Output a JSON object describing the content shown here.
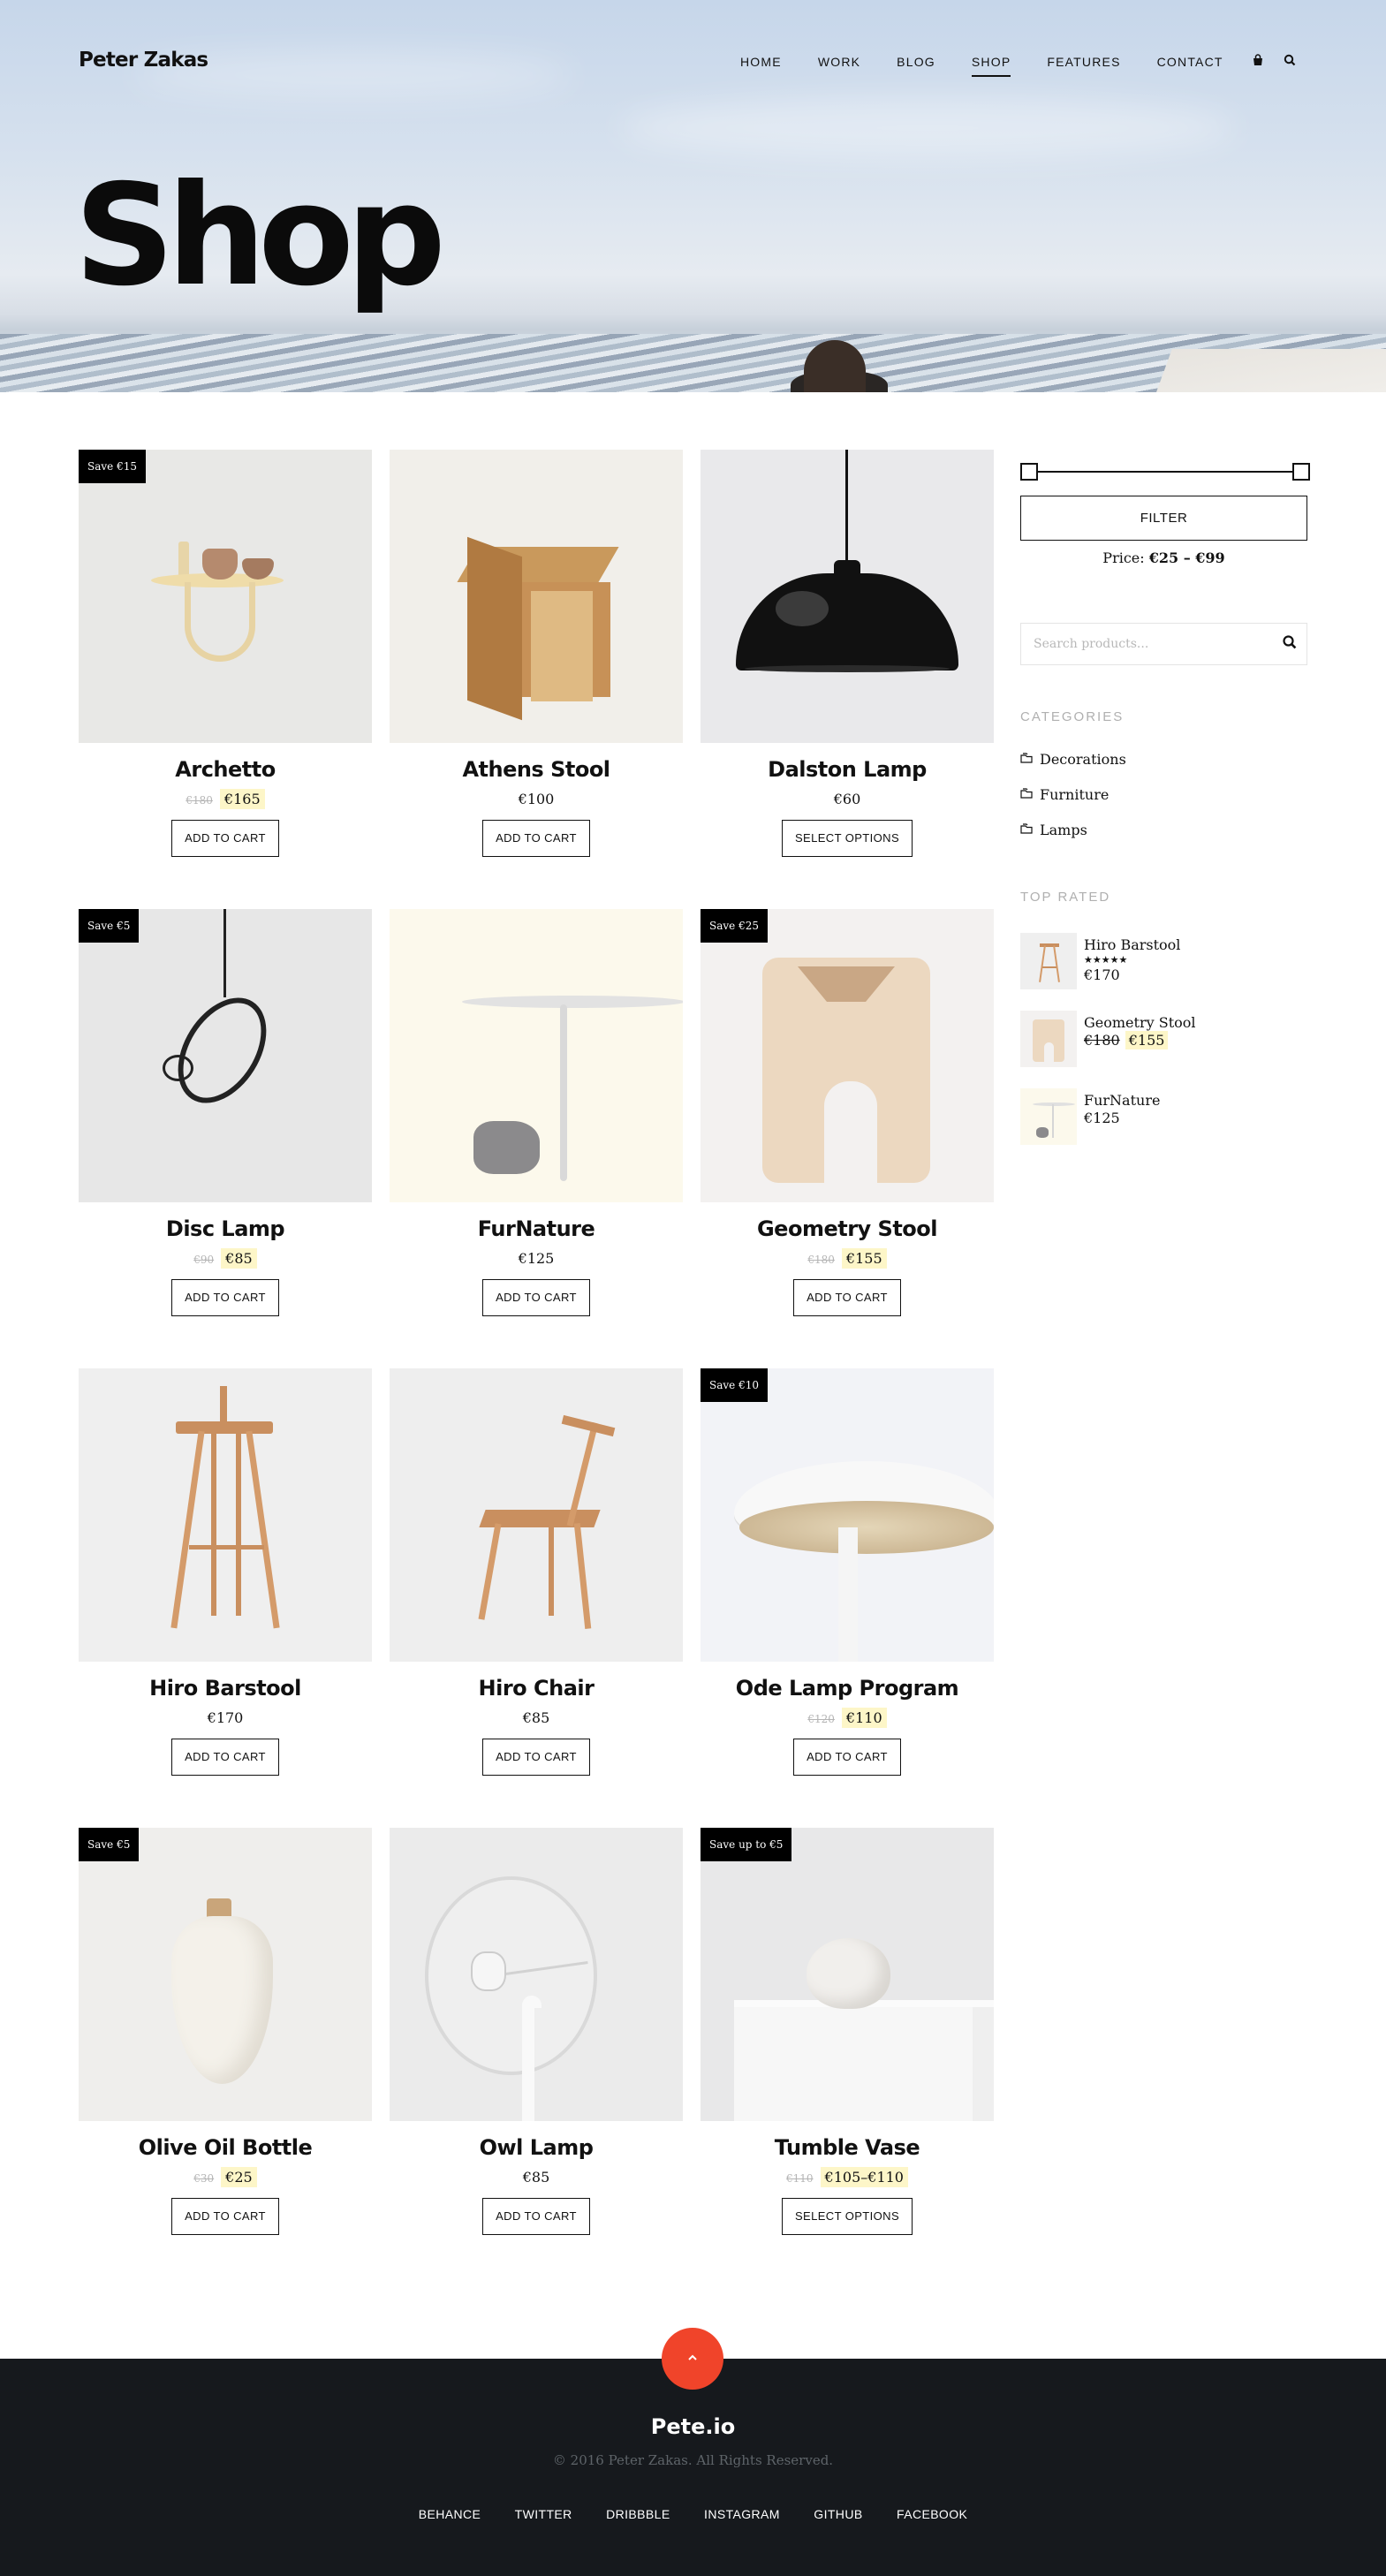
{
  "header": {
    "logo": "Peter Zakas",
    "nav": [
      {
        "label": "HOME"
      },
      {
        "label": "WORK"
      },
      {
        "label": "BLOG"
      },
      {
        "label": "SHOP",
        "active": true
      },
      {
        "label": "FEATURES"
      },
      {
        "label": "CONTACT"
      }
    ],
    "icons": [
      "shopping-bag-icon",
      "search-icon"
    ],
    "page_title": "Shop"
  },
  "products": [
    {
      "name": "Archetto",
      "badge": "Save €15",
      "old_price": "€180",
      "price": "€165",
      "button": "ADD TO CART"
    },
    {
      "name": "Athens Stool",
      "badge": "",
      "old_price": "",
      "price": "€100",
      "button": "ADD TO CART"
    },
    {
      "name": "Dalston Lamp",
      "badge": "",
      "old_price": "",
      "price": "€60",
      "button": "SELECT OPTIONS"
    },
    {
      "name": "Disc Lamp",
      "badge": "Save €5",
      "old_price": "€90",
      "price": "€85",
      "button": "ADD TO CART"
    },
    {
      "name": "FurNature",
      "badge": "",
      "old_price": "",
      "price": "€125",
      "button": "ADD TO CART"
    },
    {
      "name": "Geometry Stool",
      "badge": "Save €25",
      "old_price": "€180",
      "price": "€155",
      "button": "ADD TO CART"
    },
    {
      "name": "Hiro Barstool",
      "badge": "",
      "old_price": "",
      "price": "€170",
      "button": "ADD TO CART"
    },
    {
      "name": "Hiro Chair",
      "badge": "",
      "old_price": "",
      "price": "€85",
      "button": "ADD TO CART"
    },
    {
      "name": "Ode Lamp Program",
      "badge": "Save €10",
      "old_price": "€120",
      "price": "€110",
      "button": "ADD TO CART"
    },
    {
      "name": "Olive Oil Bottle",
      "badge": "Save €5",
      "old_price": "€30",
      "price": "€25",
      "button": "ADD TO CART"
    },
    {
      "name": "Owl Lamp",
      "badge": "",
      "old_price": "",
      "price": "€85",
      "button": "ADD TO CART"
    },
    {
      "name": "Tumble Vase",
      "badge": "Save up to €5",
      "old_price": "€110",
      "price": "€105–€110",
      "button": "SELECT OPTIONS"
    }
  ],
  "sidebar": {
    "filter_button": "FILTER",
    "price_label": "Price:",
    "price_range": "€25 – €99",
    "search_placeholder": "Search products...",
    "categories_title": "CATEGORIES",
    "categories": [
      "Decorations",
      "Furniture",
      "Lamps"
    ],
    "top_rated_title": "TOP RATED",
    "top_rated": [
      {
        "name": "Hiro Barstool",
        "rating": "★★★★★",
        "rating_value": 5,
        "old_price": "",
        "price": "€170"
      },
      {
        "name": "Geometry Stool",
        "rating": "",
        "old_price": "€180",
        "price": "€155"
      },
      {
        "name": "FurNature",
        "rating": "",
        "old_price": "",
        "price": "€125"
      }
    ]
  },
  "footer": {
    "brand": "Pete.io",
    "copyright": "© 2016 Peter Zakas. All Rights Reserved.",
    "links": [
      "BEHANCE",
      "TWITTER",
      "DRIBBBLE",
      "INSTAGRAM",
      "GITHUB",
      "FACEBOOK"
    ],
    "to_top_icon": "chevron-up-icon",
    "accent_color": "#f0442a"
  }
}
